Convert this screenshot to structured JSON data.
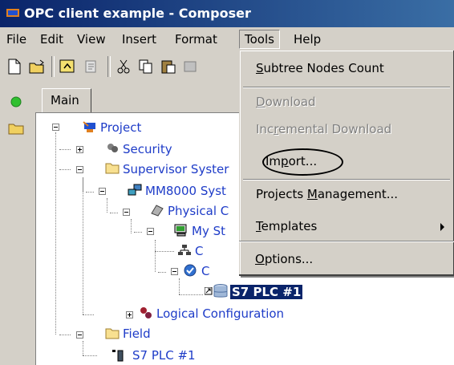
{
  "window": {
    "title": "OPC client example - Composer"
  },
  "menubar": {
    "items": [
      {
        "label": "File"
      },
      {
        "label": "Edit"
      },
      {
        "label": "View"
      },
      {
        "label": "Insert"
      },
      {
        "label": "Format"
      },
      {
        "label": "Tools"
      },
      {
        "label": "Help"
      }
    ]
  },
  "tabs": {
    "main": "Main"
  },
  "tree": {
    "project": "Project",
    "security": "Security",
    "supervisor": "Supervisor Syster",
    "mm8000": "MM8000 Syst",
    "physical": "Physical C",
    "mystation": "My St",
    "child_c1": "C",
    "child_c2": "C",
    "s7plc_selected": "S7 PLC #1",
    "logical": "Logical Configuration",
    "field": "Field",
    "s7plc_field": "S7 PLC #1"
  },
  "tools_menu": {
    "subtree_count": {
      "pre": "",
      "u": "S",
      "post": "ubtree Nodes Count"
    },
    "download": {
      "pre": "",
      "u": "D",
      "post": "ownload"
    },
    "incremental": {
      "pre": "Inc",
      "u": "r",
      "post": "emental Download"
    },
    "import": {
      "pre": "Im",
      "u": "p",
      "post": "ort..."
    },
    "projects_mgmt": {
      "pre": "Projects ",
      "u": "M",
      "post": "anagement..."
    },
    "templates": {
      "pre": "",
      "u": "T",
      "post": "emplates"
    },
    "options": {
      "pre": "",
      "u": "O",
      "post": "ptions..."
    }
  },
  "colors": {
    "title_bar": "#0a246a",
    "selection": "#0a246a",
    "tree_text": "#1e3cc8"
  }
}
